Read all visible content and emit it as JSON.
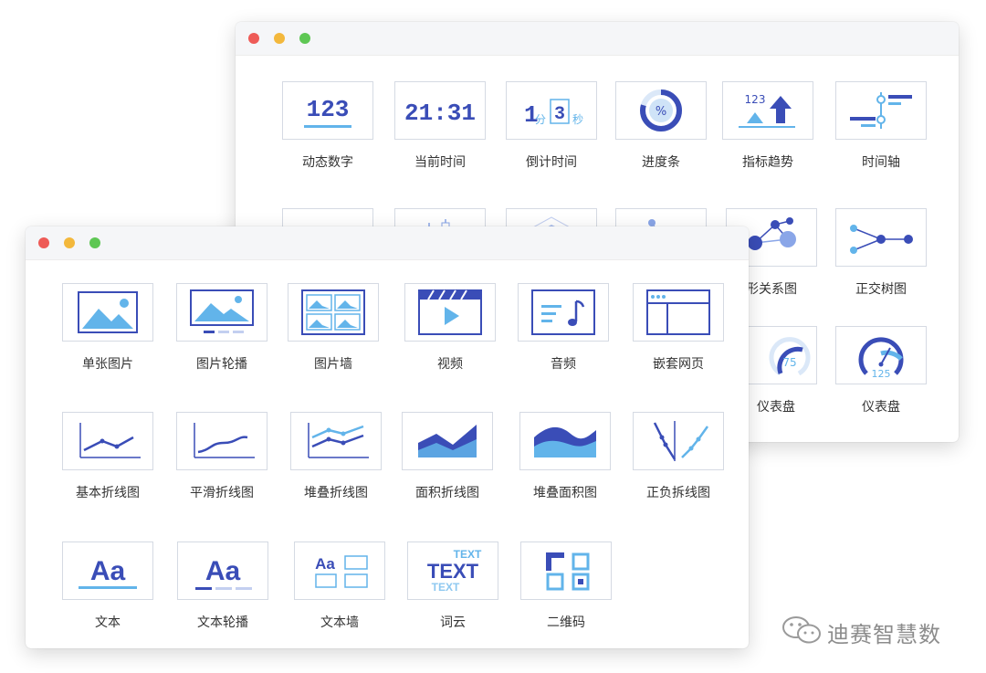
{
  "colors": {
    "accent": "#3a4db7",
    "accent_light": "#62b4ea",
    "thumb_border": "#d5dae3"
  },
  "back_window": {
    "row1": [
      "动态数字",
      "当前时间",
      "倒计时间",
      "进度条",
      "指标趋势",
      "时间轴"
    ],
    "row2_visible": [
      "形关系图",
      "正交树图"
    ],
    "row3_visible": [
      "仪表盘",
      "仪表盘"
    ],
    "thumb_text": {
      "digits": "123",
      "clock": "21:31",
      "countdown_num1": "1",
      "countdown_unit1": "分",
      "countdown_num2": "3",
      "countdown_unit2": "秒",
      "percent": "%",
      "trend_num": "123",
      "gauge1_value": "75",
      "gauge2_value": "125"
    }
  },
  "front_window": {
    "row1": [
      "单张图片",
      "图片轮播",
      "图片墙",
      "视频",
      "音频",
      "嵌套网页"
    ],
    "row2": [
      "基本折线图",
      "平滑折线图",
      "堆叠折线图",
      "面积折线图",
      "堆叠面积图",
      "正负拆线图"
    ],
    "row3": [
      "文本",
      "文本轮播",
      "文本墙",
      "词云",
      "二维码"
    ],
    "thumb_text": {
      "text_a": "Aa",
      "text_wall_a": "Aa",
      "cloud_top": "TEXT",
      "cloud_mid": "TEXT",
      "cloud_bottom": "TEXT"
    }
  },
  "watermark": {
    "text": "迪赛智慧数"
  }
}
